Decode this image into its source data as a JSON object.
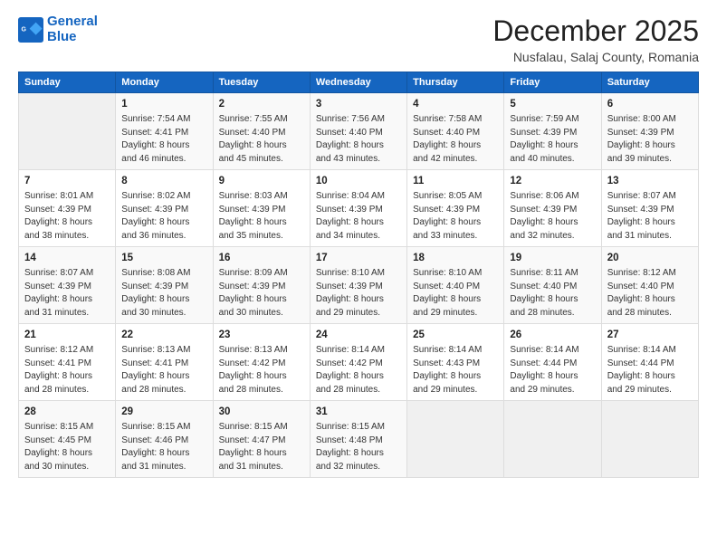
{
  "header": {
    "logo_line1": "General",
    "logo_line2": "Blue",
    "month": "December 2025",
    "location": "Nusfalau, Salaj County, Romania"
  },
  "weekdays": [
    "Sunday",
    "Monday",
    "Tuesday",
    "Wednesday",
    "Thursday",
    "Friday",
    "Saturday"
  ],
  "weeks": [
    [
      {
        "day": "",
        "info": ""
      },
      {
        "day": "1",
        "info": "Sunrise: 7:54 AM\nSunset: 4:41 PM\nDaylight: 8 hours\nand 46 minutes."
      },
      {
        "day": "2",
        "info": "Sunrise: 7:55 AM\nSunset: 4:40 PM\nDaylight: 8 hours\nand 45 minutes."
      },
      {
        "day": "3",
        "info": "Sunrise: 7:56 AM\nSunset: 4:40 PM\nDaylight: 8 hours\nand 43 minutes."
      },
      {
        "day": "4",
        "info": "Sunrise: 7:58 AM\nSunset: 4:40 PM\nDaylight: 8 hours\nand 42 minutes."
      },
      {
        "day": "5",
        "info": "Sunrise: 7:59 AM\nSunset: 4:39 PM\nDaylight: 8 hours\nand 40 minutes."
      },
      {
        "day": "6",
        "info": "Sunrise: 8:00 AM\nSunset: 4:39 PM\nDaylight: 8 hours\nand 39 minutes."
      }
    ],
    [
      {
        "day": "7",
        "info": "Sunrise: 8:01 AM\nSunset: 4:39 PM\nDaylight: 8 hours\nand 38 minutes."
      },
      {
        "day": "8",
        "info": "Sunrise: 8:02 AM\nSunset: 4:39 PM\nDaylight: 8 hours\nand 36 minutes."
      },
      {
        "day": "9",
        "info": "Sunrise: 8:03 AM\nSunset: 4:39 PM\nDaylight: 8 hours\nand 35 minutes."
      },
      {
        "day": "10",
        "info": "Sunrise: 8:04 AM\nSunset: 4:39 PM\nDaylight: 8 hours\nand 34 minutes."
      },
      {
        "day": "11",
        "info": "Sunrise: 8:05 AM\nSunset: 4:39 PM\nDaylight: 8 hours\nand 33 minutes."
      },
      {
        "day": "12",
        "info": "Sunrise: 8:06 AM\nSunset: 4:39 PM\nDaylight: 8 hours\nand 32 minutes."
      },
      {
        "day": "13",
        "info": "Sunrise: 8:07 AM\nSunset: 4:39 PM\nDaylight: 8 hours\nand 31 minutes."
      }
    ],
    [
      {
        "day": "14",
        "info": "Sunrise: 8:07 AM\nSunset: 4:39 PM\nDaylight: 8 hours\nand 31 minutes."
      },
      {
        "day": "15",
        "info": "Sunrise: 8:08 AM\nSunset: 4:39 PM\nDaylight: 8 hours\nand 30 minutes."
      },
      {
        "day": "16",
        "info": "Sunrise: 8:09 AM\nSunset: 4:39 PM\nDaylight: 8 hours\nand 30 minutes."
      },
      {
        "day": "17",
        "info": "Sunrise: 8:10 AM\nSunset: 4:39 PM\nDaylight: 8 hours\nand 29 minutes."
      },
      {
        "day": "18",
        "info": "Sunrise: 8:10 AM\nSunset: 4:40 PM\nDaylight: 8 hours\nand 29 minutes."
      },
      {
        "day": "19",
        "info": "Sunrise: 8:11 AM\nSunset: 4:40 PM\nDaylight: 8 hours\nand 28 minutes."
      },
      {
        "day": "20",
        "info": "Sunrise: 8:12 AM\nSunset: 4:40 PM\nDaylight: 8 hours\nand 28 minutes."
      }
    ],
    [
      {
        "day": "21",
        "info": "Sunrise: 8:12 AM\nSunset: 4:41 PM\nDaylight: 8 hours\nand 28 minutes."
      },
      {
        "day": "22",
        "info": "Sunrise: 8:13 AM\nSunset: 4:41 PM\nDaylight: 8 hours\nand 28 minutes."
      },
      {
        "day": "23",
        "info": "Sunrise: 8:13 AM\nSunset: 4:42 PM\nDaylight: 8 hours\nand 28 minutes."
      },
      {
        "day": "24",
        "info": "Sunrise: 8:14 AM\nSunset: 4:42 PM\nDaylight: 8 hours\nand 28 minutes."
      },
      {
        "day": "25",
        "info": "Sunrise: 8:14 AM\nSunset: 4:43 PM\nDaylight: 8 hours\nand 29 minutes."
      },
      {
        "day": "26",
        "info": "Sunrise: 8:14 AM\nSunset: 4:44 PM\nDaylight: 8 hours\nand 29 minutes."
      },
      {
        "day": "27",
        "info": "Sunrise: 8:14 AM\nSunset: 4:44 PM\nDaylight: 8 hours\nand 29 minutes."
      }
    ],
    [
      {
        "day": "28",
        "info": "Sunrise: 8:15 AM\nSunset: 4:45 PM\nDaylight: 8 hours\nand 30 minutes."
      },
      {
        "day": "29",
        "info": "Sunrise: 8:15 AM\nSunset: 4:46 PM\nDaylight: 8 hours\nand 31 minutes."
      },
      {
        "day": "30",
        "info": "Sunrise: 8:15 AM\nSunset: 4:47 PM\nDaylight: 8 hours\nand 31 minutes."
      },
      {
        "day": "31",
        "info": "Sunrise: 8:15 AM\nSunset: 4:48 PM\nDaylight: 8 hours\nand 32 minutes."
      },
      {
        "day": "",
        "info": ""
      },
      {
        "day": "",
        "info": ""
      },
      {
        "day": "",
        "info": ""
      }
    ]
  ]
}
